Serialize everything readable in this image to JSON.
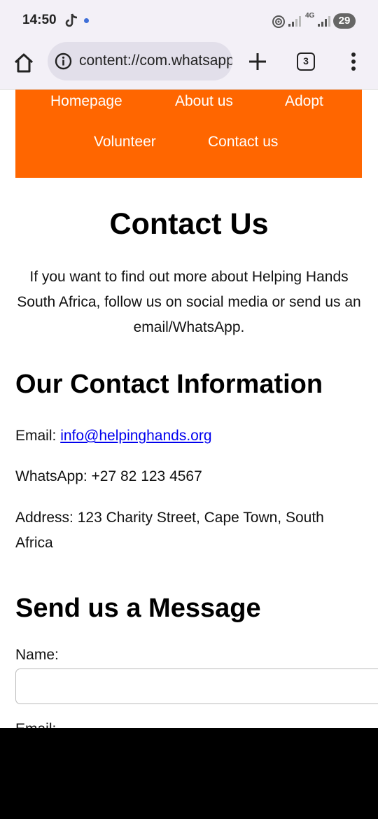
{
  "status_bar": {
    "time": "14:50",
    "network": "4G",
    "battery": "29"
  },
  "browser": {
    "url": "content://com.whatsapp.provider.media",
    "tab_count": "3"
  },
  "nav": {
    "items": [
      "Homepage",
      "About us",
      "Adopt",
      "Volunteer",
      "Contact us"
    ],
    "background": "#ff6600"
  },
  "page": {
    "title": "Contact Us",
    "intro": "If you want to find out more about Helping Hands South Africa, follow us on social media or send us an email/WhatsApp.",
    "contact_heading": "Our Contact Information",
    "email_label": "Email:",
    "email_value": "info@helpinghands.org",
    "whatsapp": "WhatsApp: +27 82 123 4567",
    "address": "Address: 123 Charity Street, Cape Town, South Africa",
    "form_heading": "Send us a Message",
    "name_label": "Name:",
    "email_field_label": "Email:"
  }
}
